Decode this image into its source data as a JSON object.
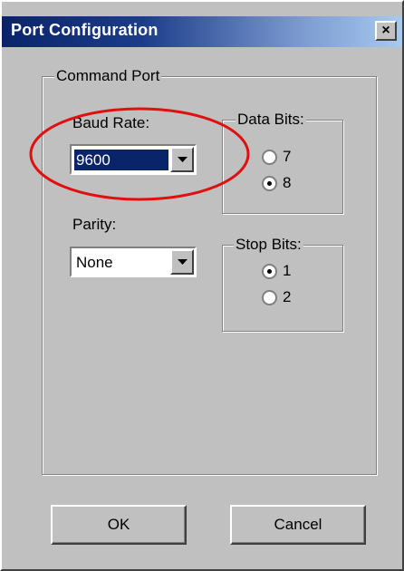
{
  "dialog": {
    "title": "Port Configuration",
    "close_symbol": "×"
  },
  "command_port": {
    "group_label": "Command Port",
    "baud_rate": {
      "label": "Baud Rate:",
      "value": "9600"
    },
    "parity": {
      "label": "Parity:",
      "value": "None"
    },
    "data_bits": {
      "label": "Data Bits:",
      "options": [
        {
          "label": "7",
          "selected": false
        },
        {
          "label": "8",
          "selected": true
        }
      ]
    },
    "stop_bits": {
      "label": "Stop Bits:",
      "options": [
        {
          "label": "1",
          "selected": true
        },
        {
          "label": "2",
          "selected": false
        }
      ]
    }
  },
  "buttons": {
    "ok": "OK",
    "cancel": "Cancel"
  },
  "annotation": {
    "shape": "red-ellipse",
    "color": "#e01010",
    "highlights": "baud-rate"
  },
  "colors": {
    "face": "#c0c0c0",
    "title_start": "#0a246a",
    "title_end": "#a6caf0",
    "selection": "#0a246a"
  }
}
